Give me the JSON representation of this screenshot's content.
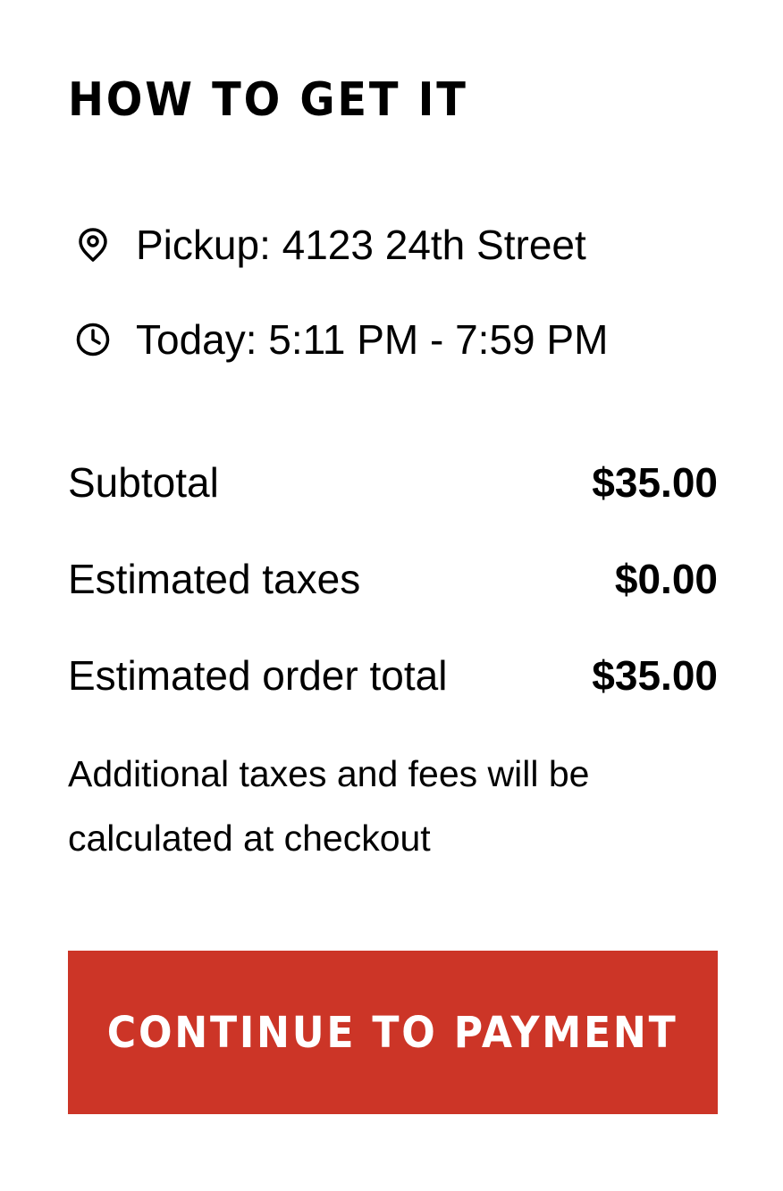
{
  "section": {
    "title": "HOW TO GET IT"
  },
  "fulfillment": {
    "pickup": {
      "icon": "location-pin-icon",
      "text": "Pickup: 4123 24th Street"
    },
    "time": {
      "icon": "clock-icon",
      "text": "Today: 5:11 PM - 7:59 PM"
    }
  },
  "summary": {
    "rows": [
      {
        "label": "Subtotal",
        "value": "$35.00"
      },
      {
        "label": "Estimated taxes",
        "value": "$0.00"
      },
      {
        "label": "Estimated order total",
        "value": "$35.00"
      }
    ],
    "note": "Additional taxes and fees will be calculated at checkout"
  },
  "actions": {
    "continue_label": "CONTINUE TO PAYMENT",
    "button_color": "#cc3527"
  }
}
